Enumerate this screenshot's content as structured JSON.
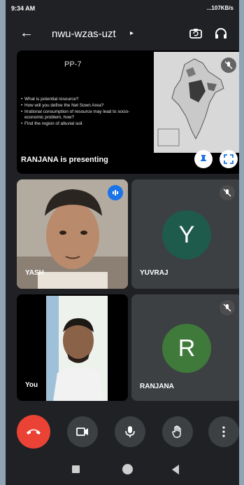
{
  "status": {
    "time": "9:34 AM",
    "right_text": "...107KB/s"
  },
  "header": {
    "meeting_code": "nwu-wzas-uzt",
    "caret": "▸",
    "back_icon": "arrow-left-icon",
    "switch_icon": "camera-switch-icon",
    "audio_icon": "headphones-icon"
  },
  "presentation": {
    "slide_title": "PP-7",
    "bullets": [
      "What is potential resource?",
      "How will you define the Net Sown Area?",
      "Irrational consumption of resource may lead to socio-economic problem, how?",
      "Find the region of alluvial soil."
    ],
    "presenting_label": "RANJANA is presenting"
  },
  "tiles": {
    "yash": {
      "name": "YASH",
      "status_icon": "speaking-icon"
    },
    "yuvraj": {
      "name": "YUVRAJ",
      "initial": "Y",
      "color": "#1e5b4c",
      "status_icon": "mic-off-icon"
    },
    "you": {
      "name": "You"
    },
    "ranjana": {
      "name": "RANJANA",
      "initial": "R",
      "color": "#3f7a3a",
      "status_icon": "mic-off-icon"
    }
  },
  "controls": {
    "hangup_color": "#ea4335",
    "icons": [
      "end-call-icon",
      "camera-icon",
      "mic-icon",
      "raise-hand-icon",
      "more-vertical-icon"
    ]
  }
}
